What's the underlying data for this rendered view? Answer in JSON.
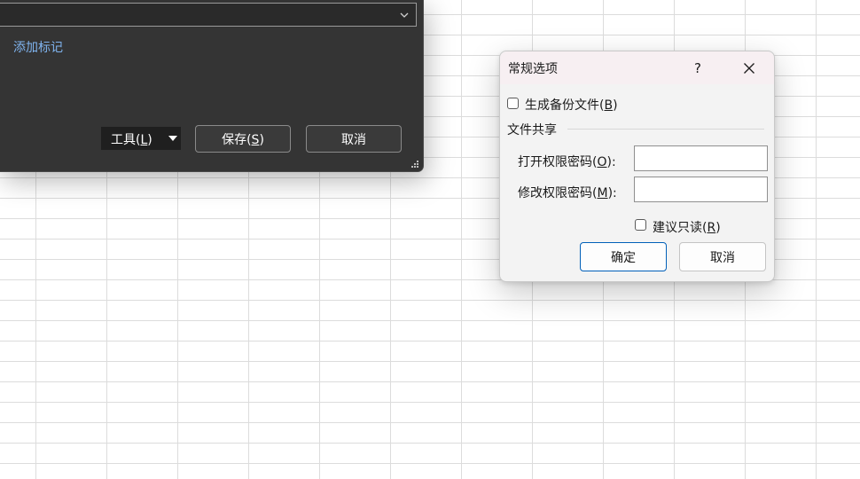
{
  "save_dialog": {
    "add_tag_link": "添加标记",
    "tools_button": {
      "label": "工具",
      "accel": "L"
    },
    "save_button": {
      "label": "保存",
      "accel": "S"
    },
    "cancel_button": "取消",
    "combo_chevron_icon": "chevron-down-icon",
    "resize_grip_icon": "resize-grip-icon"
  },
  "options_dialog": {
    "title": "常规选项",
    "help_button": "?",
    "close_icon": "close-icon",
    "backup_checkbox": {
      "label": "生成备份文件",
      "accel": "B",
      "checked": false
    },
    "file_sharing_section": "文件共享",
    "open_password": {
      "label": "打开权限密码",
      "accel": "O",
      "value": ""
    },
    "modify_password": {
      "label": "修改权限密码",
      "accel": "M",
      "value": ""
    },
    "readonly_checkbox": {
      "label": "建议只读",
      "accel": "R",
      "checked": false
    },
    "ok_button": "确定",
    "cancel_button": "取消"
  },
  "colors": {
    "dark_dialog_bg": "#343434",
    "link_blue": "#7fb3ee",
    "primary_button_border": "#005fb8",
    "options_titlebar_bg": "#f7eff2"
  }
}
